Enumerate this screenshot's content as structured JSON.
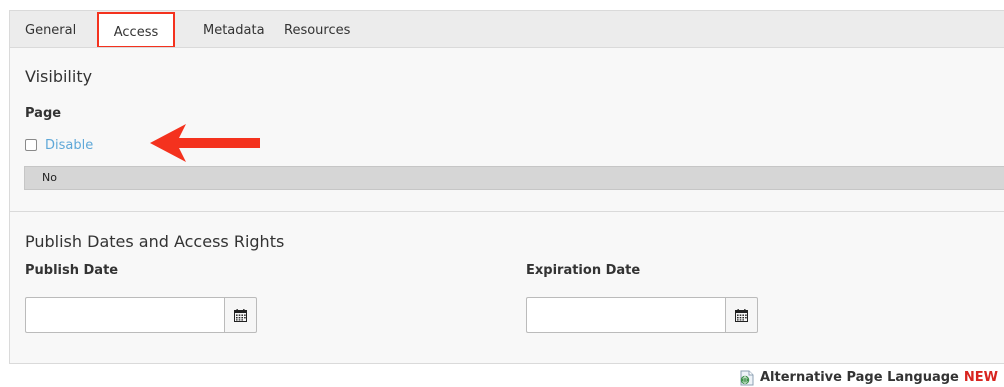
{
  "tabs": {
    "items": [
      {
        "label": "General",
        "active": false
      },
      {
        "label": "Access",
        "active": true
      },
      {
        "label": "Metadata",
        "active": false
      },
      {
        "label": "Resources",
        "active": false
      }
    ]
  },
  "visibility": {
    "title": "Visibility",
    "page_label": "Page",
    "disable": {
      "label": "Disable",
      "checked": false,
      "value_text": "No"
    }
  },
  "publish": {
    "title": "Publish Dates and Access Rights",
    "publish_date": {
      "label": "Publish Date",
      "value": "",
      "icon": "calendar-icon"
    },
    "expiration_date": {
      "label": "Expiration Date",
      "value": "",
      "icon": "calendar-icon"
    }
  },
  "footer": {
    "alternative_language_label": "Alternative Page Language",
    "new_badge": "NEW",
    "icon": "page-language-icon"
  },
  "colors": {
    "tab_highlight_border": "#f4321e",
    "disable_label": "#5fa8d8",
    "new_badge": "#d8241f",
    "arrow": "#f4321e",
    "value_bar": "#d6d6d6",
    "panel_background": "#f8f8f8"
  }
}
